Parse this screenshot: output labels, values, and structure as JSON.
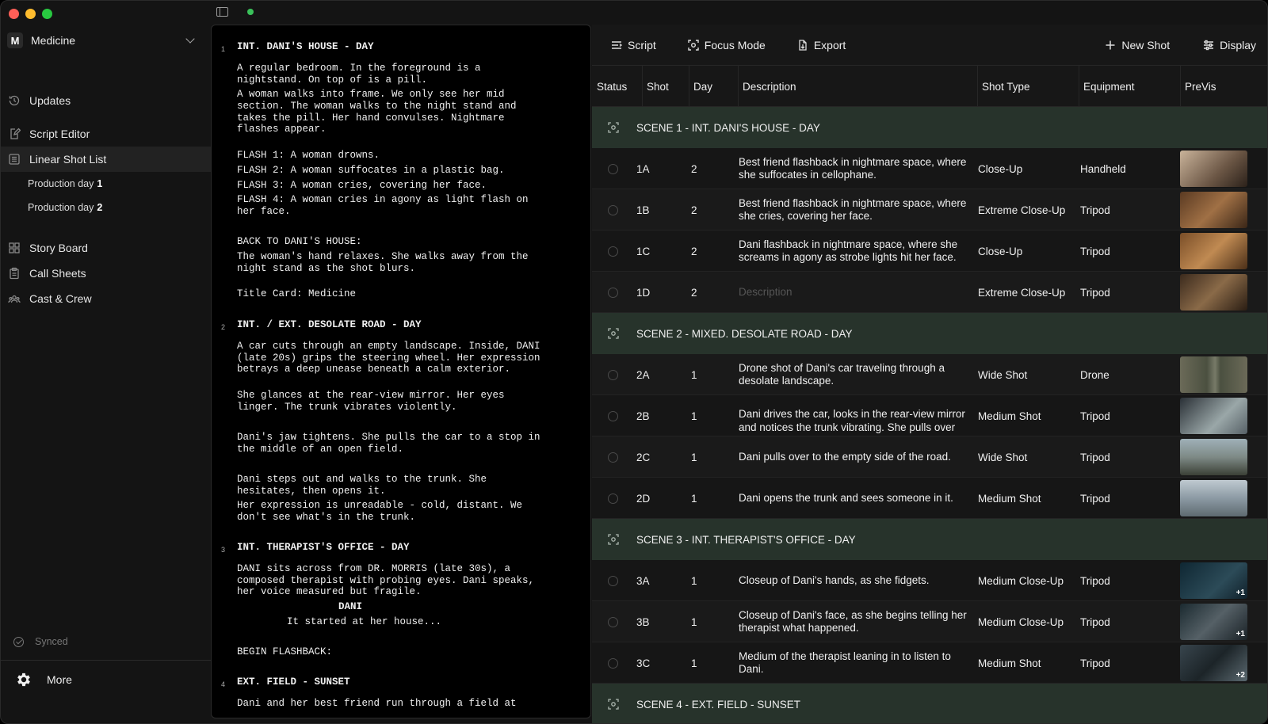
{
  "window": {
    "lights": [
      "#ff5f57",
      "#febc2e",
      "#28c840"
    ],
    "accent_green": "#3ac15a",
    "scene_row_color": "#27332b"
  },
  "sidebar": {
    "workspace_badge": "M",
    "workspace_name": "Medicine",
    "nav": [
      {
        "label": "Updates",
        "icon": "history-icon"
      },
      {
        "label": "Script Editor",
        "icon": "edit-document-icon"
      },
      {
        "label": "Linear Shot List",
        "icon": "list-icon",
        "active": true
      },
      {
        "label": "Story Board",
        "icon": "storyboard-grid-icon"
      },
      {
        "label": "Call Sheets",
        "icon": "clipboard-icon"
      },
      {
        "label": "Cast & Crew",
        "icon": "people-icon"
      }
    ],
    "sub_items": [
      {
        "label": "Production day",
        "num": "1"
      },
      {
        "label": "Production day",
        "num": "2"
      }
    ],
    "synced_label": "Synced",
    "more_label": "More"
  },
  "script": {
    "scenes": [
      {
        "num": "1",
        "heading": "INT. DANI'S HOUSE - DAY"
      },
      {
        "num": "2",
        "heading": "INT. / EXT. DESOLATE ROAD - DAY"
      },
      {
        "num": "3",
        "heading": "INT. THERAPIST'S OFFICE - DAY"
      },
      {
        "num": "4",
        "heading": "EXT. FIELD - SUNSET"
      }
    ],
    "lines": [
      "A regular bedroom. In the foreground is a",
      "nightstand. On top of is a pill.",
      "A woman walks into frame. We only see her mid",
      "section. The woman walks to the night stand and",
      "takes the pill. Her hand convulses. Nightmare",
      "flashes appear.",
      "FLASH 1: A woman drowns.",
      "FLASH 2: A woman suffocates in a plastic bag.",
      "FLASH 3: A woman cries, covering her face.",
      "FLASH 4: A woman cries in agony as light flash on",
      "her face.",
      "BACK TO DANI'S HOUSE:",
      "The woman's hand relaxes. She walks away from the",
      "night stand as the shot blurs.",
      "Title Card: Medicine",
      "A car cuts through an empty landscape. Inside, DANI",
      "(late 20s) grips the steering wheel. Her expression",
      "betrays a deep unease beneath a calm exterior.",
      "She glances at the rear-view mirror. Her eyes",
      "linger. The trunk vibrates violently.",
      "Dani's jaw tightens. She pulls the car to a stop in",
      "the middle of an open field.",
      "Dani steps out and walks to the trunk. She",
      "hesitates, then opens it.",
      "Her expression is unreadable - cold, distant. We",
      "don't see what's in the trunk.",
      "DANI sits across from DR. MORRIS (late 30s), a",
      "composed therapist with probing eyes. Dani speaks,",
      "her voice measured but fragile.",
      "DANI",
      "It started at her house...",
      "BEGIN FLASHBACK:",
      "Dani and her best friend run through a field at"
    ]
  },
  "toolbar": {
    "script": "Script",
    "focus": "Focus Mode",
    "export": "Export",
    "new_shot": "New Shot",
    "display": "Display"
  },
  "table": {
    "headers": {
      "status": "Status",
      "shot": "Shot",
      "day": "Day",
      "description": "Description",
      "shot_type": "Shot Type",
      "equipment": "Equipment",
      "previs": "PreVis"
    },
    "scenes": [
      {
        "label": "SCENE 1 - INT. DANI'S HOUSE - DAY"
      },
      {
        "label": "SCENE 2 - MIXED. DESOLATE ROAD - DAY"
      },
      {
        "label": "SCENE 3 - INT. THERAPIST'S OFFICE - DAY"
      },
      {
        "label": "SCENE 4 - EXT. FIELD - SUNSET"
      }
    ],
    "shots": [
      {
        "shot": "1A",
        "day": "2",
        "desc": "Best friend flashback in nightmare space, where she suffocates in cellophane.",
        "type": "Close-Up",
        "equip": "Handheld",
        "extra": ""
      },
      {
        "shot": "1B",
        "day": "2",
        "desc": "Best friend flashback in nightmare space, where she cries, covering her face.",
        "type": "Extreme Close-Up",
        "equip": "Tripod",
        "extra": ""
      },
      {
        "shot": "1C",
        "day": "2",
        "desc": "Dani flashback in nightmare space, where she screams in agony as strobe lights hit her face.",
        "type": "Close-Up",
        "equip": "Tripod",
        "extra": ""
      },
      {
        "shot": "1D",
        "day": "2",
        "desc": "Description",
        "type": "Extreme Close-Up",
        "equip": "Tripod",
        "extra": ""
      },
      {
        "shot": "2A",
        "day": "1",
        "desc": "Drone shot of Dani's car traveling through a desolate landscape.",
        "type": "Wide Shot",
        "equip": "Drone",
        "extra": ""
      },
      {
        "shot": "2B",
        "day": "1",
        "desc": "Dani drives the car, looks in the rear-view mirror and notices the trunk vibrating. She pulls over",
        "type": "Medium Shot",
        "equip": "Tripod",
        "extra": ""
      },
      {
        "shot": "2C",
        "day": "1",
        "desc": "Dani pulls over to the empty side of the road.",
        "type": "Wide Shot",
        "equip": "Tripod",
        "extra": ""
      },
      {
        "shot": "2D",
        "day": "1",
        "desc": "Dani opens the trunk and sees someone in it.",
        "type": "Medium Shot",
        "equip": "Tripod",
        "extra": ""
      },
      {
        "shot": "3A",
        "day": "1",
        "desc": "Closeup of Dani's hands, as she fidgets.",
        "type": "Medium Close-Up",
        "equip": "Tripod",
        "extra": "+1"
      },
      {
        "shot": "3B",
        "day": "1",
        "desc": "Closeup of Dani's face, as she begins telling her therapist what happened.",
        "type": "Medium Close-Up",
        "equip": "Tripod",
        "extra": "+1"
      },
      {
        "shot": "3C",
        "day": "1",
        "desc": "Medium of the therapist leaning in to listen to Dani.",
        "type": "Medium Shot",
        "equip": "Tripod",
        "extra": "+2"
      }
    ]
  }
}
